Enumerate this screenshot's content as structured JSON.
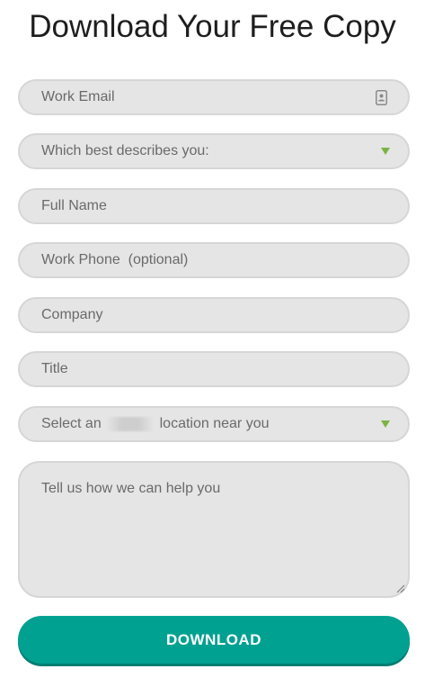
{
  "header": {
    "title": "Download Your Free Copy"
  },
  "form": {
    "work_email": {
      "placeholder": "Work Email",
      "icon": "contact-card-icon"
    },
    "role_select": {
      "value": "Which best describes you:",
      "icon": "caret-down-icon"
    },
    "full_name": {
      "placeholder": "Full Name"
    },
    "work_phone": {
      "placeholder": "Work Phone  (optional)"
    },
    "company": {
      "placeholder": "Company"
    },
    "title_field": {
      "placeholder": "Title"
    },
    "location_select": {
      "value_prefix": "Select an",
      "value_suffix": "location near you",
      "icon": "caret-down-icon"
    },
    "message": {
      "placeholder": "Tell us how we can help you"
    },
    "submit_label": "DOWNLOAD"
  },
  "colors": {
    "accent": "#00a191",
    "caret": "#7cb342",
    "field_background": "#e5e5e5",
    "placeholder": "#6a6a6a",
    "title": "#1e1e1e"
  }
}
